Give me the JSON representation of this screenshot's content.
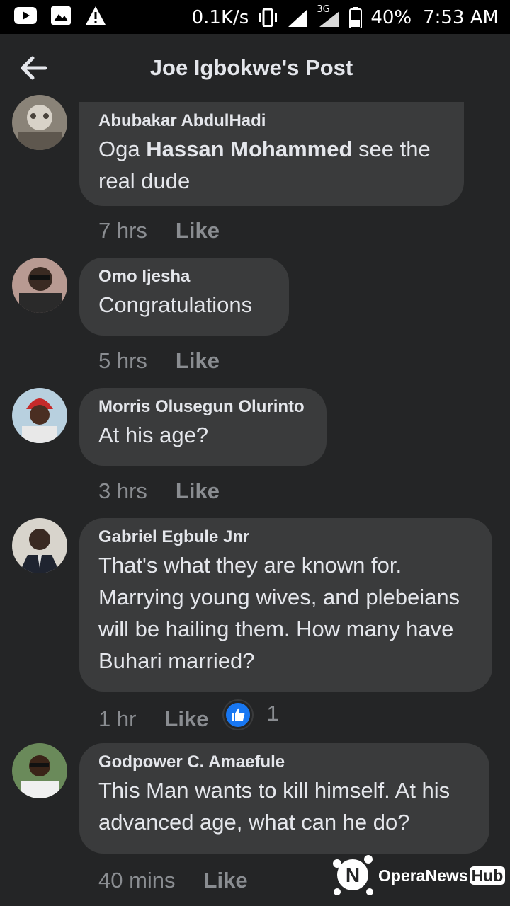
{
  "status_bar": {
    "speed": "0.1K/s",
    "network": "3G",
    "battery": "40%",
    "time": "7:53 AM"
  },
  "header": {
    "title": "Joe Igbokwe's Post"
  },
  "comments": [
    {
      "author": "Abubakar AbdulHadi",
      "text_prefix": "Oga",
      "mention": "Hassan Mohammed",
      "text_suffix": "see the real dude",
      "time": "7 hrs",
      "like_label": "Like"
    },
    {
      "author": "Omo Ijesha",
      "text": "Congratulations",
      "time": "5 hrs",
      "like_label": "Like"
    },
    {
      "author": "Morris Olusegun Olurinto",
      "text": "At his age?",
      "time": "3 hrs",
      "like_label": "Like"
    },
    {
      "author": "Gabriel Egbule Jnr",
      "text": "That's what they are known for. Marrying young wives, and plebeians will be hailing them. How many have Buhari married?",
      "time": "1 hr",
      "like_label": "Like",
      "reaction_count": "1",
      "reaction_icon": "thumbs-up-icon",
      "reaction_color": "#1877f2"
    },
    {
      "author": "Godpower C. Amaefule",
      "text": "This Man wants to kill himself. At his advanced age, what can he do?",
      "time": "40 mins",
      "like_label": "Like"
    }
  ],
  "watermark": {
    "brand": "OperaNews",
    "suffix": "Hub"
  },
  "colors": {
    "background": "#242526",
    "bubble": "#3a3b3c",
    "text": "#e4e6eb",
    "meta": "#8a8d91"
  }
}
